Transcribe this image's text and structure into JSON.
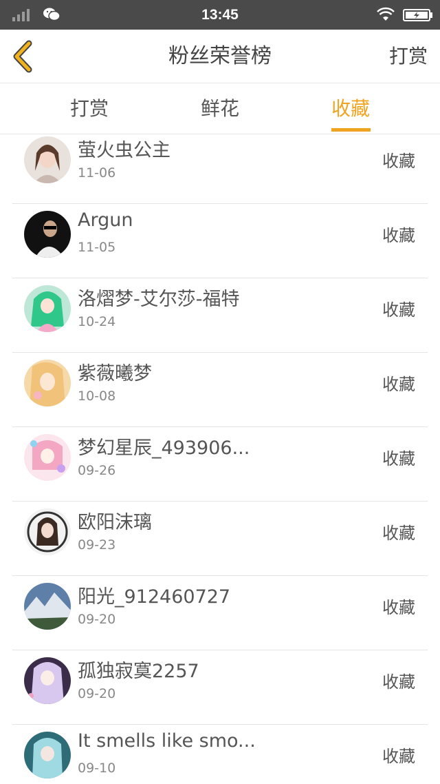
{
  "status": {
    "time": "13:45"
  },
  "nav": {
    "title": "粉丝荣誉榜",
    "right": "打赏"
  },
  "tabs": [
    {
      "label": "打赏"
    },
    {
      "label": "鲜花"
    },
    {
      "label": "收藏"
    }
  ],
  "active_tab": "收藏",
  "accent_color": "#f0a31f",
  "rows": [
    {
      "name": "萤火虫公主",
      "date": "11-06",
      "action": "收藏"
    },
    {
      "name": "Argun",
      "date": "11-05",
      "action": "收藏"
    },
    {
      "name": "洛熠梦-艾尔莎-福特",
      "date": "10-24",
      "action": "收藏"
    },
    {
      "name": "紫薇曦梦",
      "date": "10-08",
      "action": "收藏"
    },
    {
      "name": "梦幻星辰_493906...",
      "date": "09-26",
      "action": "收藏"
    },
    {
      "name": "欧阳沫璃",
      "date": "09-23",
      "action": "收藏"
    },
    {
      "name": "阳光_912460727",
      "date": "09-20",
      "action": "收藏"
    },
    {
      "name": "孤独寂寞2257",
      "date": "09-20",
      "action": "收藏"
    },
    {
      "name": "It smells like smo...",
      "date": "09-10",
      "action": "收藏"
    }
  ]
}
